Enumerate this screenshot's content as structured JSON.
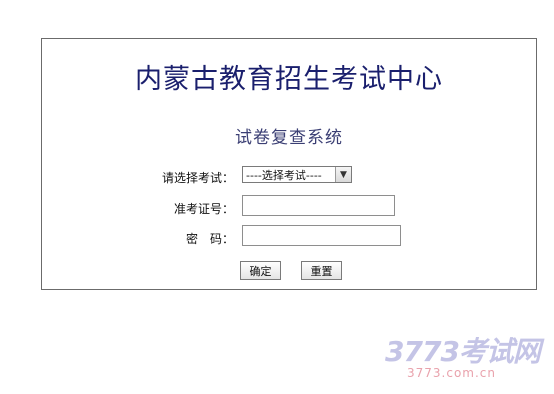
{
  "header": {
    "title": "内蒙古教育招生考试中心",
    "subtitle": "试卷复查系统"
  },
  "form": {
    "exam_label": "请选择考试：",
    "exam_selected": "----选择考试----",
    "ticket_label": "准考证号：",
    "ticket_value": "",
    "password_label": "密　码：",
    "password_value": "",
    "submit_label": "确定",
    "reset_label": "重置"
  },
  "watermark": {
    "logo_text": "3773考试网",
    "url_text": "3773.com.cn"
  }
}
